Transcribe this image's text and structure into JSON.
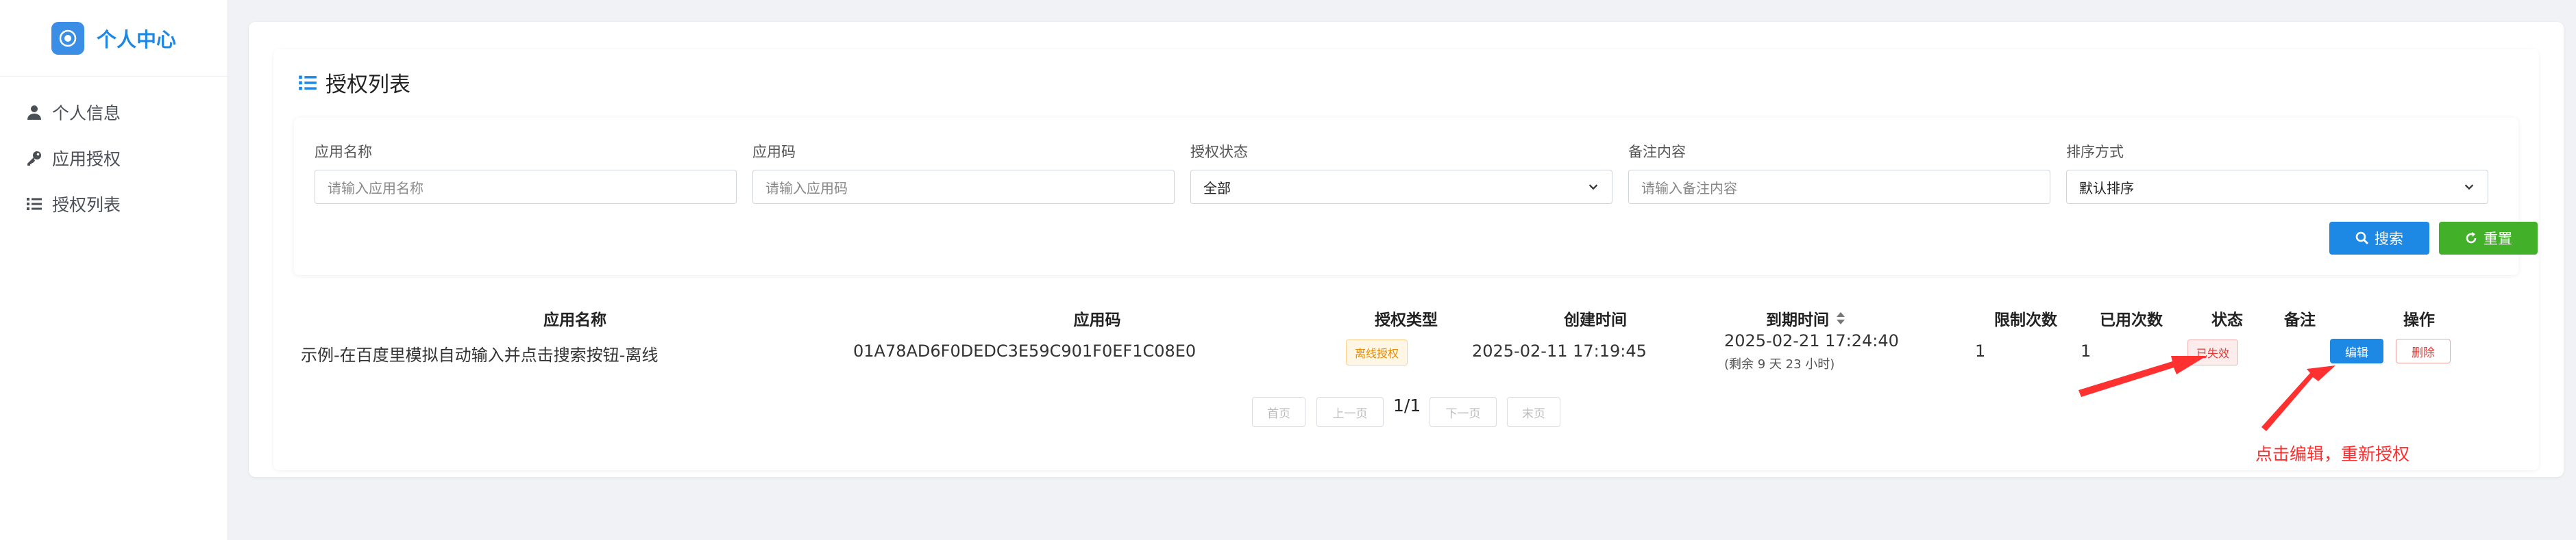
{
  "sidebar": {
    "brand_title": "个人中心",
    "items": [
      {
        "label": "个人信息",
        "icon": "user-icon"
      },
      {
        "label": "应用授权",
        "icon": "key-icon"
      },
      {
        "label": "授权列表",
        "icon": "list-icon"
      }
    ]
  },
  "card": {
    "title": "授权列表"
  },
  "filters": {
    "app_name": {
      "label": "应用名称",
      "placeholder": "请输入应用名称"
    },
    "app_code": {
      "label": "应用码",
      "placeholder": "请输入应用码"
    },
    "status": {
      "label": "授权状态",
      "value": "全部"
    },
    "remark": {
      "label": "备注内容",
      "placeholder": "请输入备注内容"
    },
    "sort": {
      "label": "排序方式",
      "value": "默认排序"
    },
    "search_label": "搜索",
    "reset_label": "重置"
  },
  "table": {
    "headers": {
      "app_name": "应用名称",
      "app_code": "应用码",
      "auth_type": "授权类型",
      "created": "创建时间",
      "expire": "到期时间",
      "limit": "限制次数",
      "used": "已用次数",
      "status": "状态",
      "remark": "备注",
      "action": "操作"
    },
    "rows": [
      {
        "app_name": "示例-在百度里模拟自动输入并点击搜索按钮-离线",
        "app_code": "01A78AD6F0DEDC3E59C901F0EF1C08E0",
        "auth_type": "离线授权",
        "created": "2025-02-11 17:19:45",
        "expire": "2025-02-21 17:24:40",
        "expire_note": "(剩余 9 天 23 小时)",
        "limit": "1",
        "used": "1",
        "status": "已失效",
        "remark": "",
        "edit_label": "编辑",
        "delete_label": "删除"
      }
    ]
  },
  "pagination": {
    "first": "首页",
    "prev": "上一页",
    "info": "1/1",
    "next": "下一页",
    "last": "末页"
  },
  "annotation": {
    "text": "点击编辑，重新授权"
  },
  "colors": {
    "primary": "#1e88e5",
    "success": "#43b02a",
    "danger": "#e53935",
    "warning": "#e68a00",
    "annotation": "#ff2d2d"
  }
}
